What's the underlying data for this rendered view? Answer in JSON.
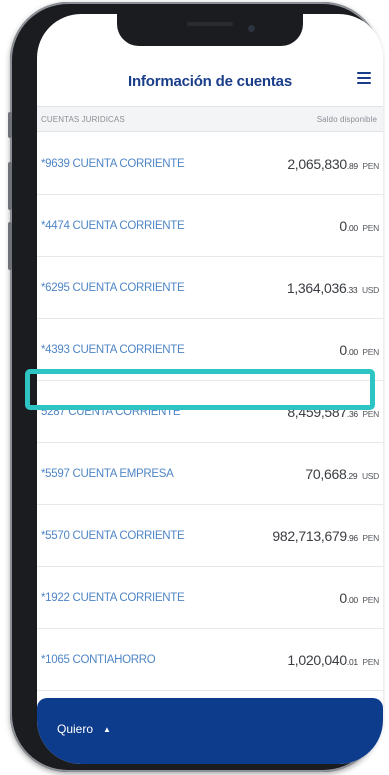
{
  "header": {
    "title": "Información de cuentas"
  },
  "subheader": {
    "left": "CUENTAS JURIDICAS",
    "right": "Saldo disponible"
  },
  "accounts": [
    {
      "name": "*9639 CUENTA CORRIENTE",
      "int": "2,065,830",
      "dec": ".89",
      "currency": "PEN"
    },
    {
      "name": "*4474 CUENTA CORRIENTE",
      "int": "0",
      "dec": ".00",
      "currency": "PEN"
    },
    {
      "name": "*6295 CUENTA CORRIENTE",
      "int": "1,364,036",
      "dec": ".33",
      "currency": "USD"
    },
    {
      "name": "*4393 CUENTA CORRIENTE",
      "int": "0",
      "dec": ".00",
      "currency": "PEN"
    },
    {
      "name": "5287 CUENTA CORRIENTE",
      "int": "8,459,587",
      "dec": ".36",
      "currency": "PEN"
    },
    {
      "name": "*5597 CUENTA EMPRESA",
      "int": "70,668",
      "dec": ".29",
      "currency": "USD"
    },
    {
      "name": "*5570 CUENTA CORRIENTE",
      "int": "982,713,679",
      "dec": ".96",
      "currency": "PEN"
    },
    {
      "name": "*1922 CUENTA CORRIENTE",
      "int": "0",
      "dec": ".00",
      "currency": "PEN"
    },
    {
      "name": "*1065 CONTIAHORRO",
      "int": "1,020,040",
      "dec": ".01",
      "currency": "PEN"
    }
  ],
  "footer": {
    "label": "Quiero",
    "caret_icon": "caret-up-icon"
  },
  "colors": {
    "brand": "#0d3c8c",
    "link": "#4f86c6",
    "highlight": "#2ec4c4"
  }
}
